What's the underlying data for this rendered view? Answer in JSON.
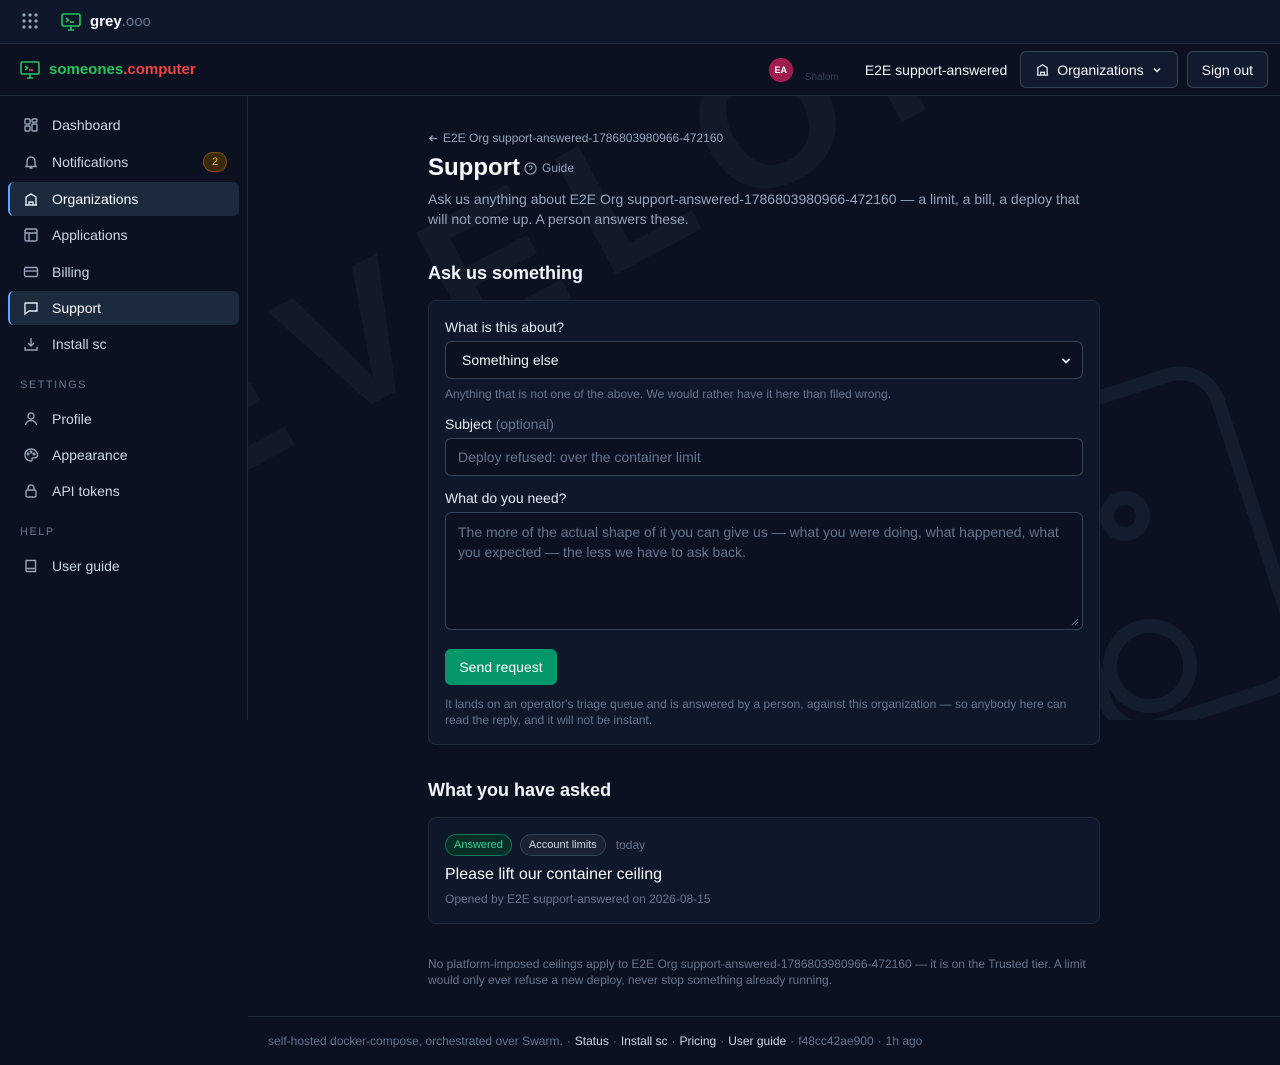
{
  "topbar": {
    "brand_name": "grey",
    "brand_tld": ".ooo"
  },
  "header": {
    "brand_name": "someones",
    "brand_tld": ".computer",
    "avatar_initials": "EA",
    "avatar_sub": "Shalom",
    "user_name": "E2E support-answered",
    "org_button": "Organizations",
    "signout_button": "Sign out"
  },
  "sidebar": {
    "items": [
      {
        "label": "Dashboard"
      },
      {
        "label": "Notifications",
        "badge": "2"
      },
      {
        "label": "Organizations"
      },
      {
        "label": "Applications"
      },
      {
        "label": "Billing"
      },
      {
        "label": "Support"
      },
      {
        "label": "Install sc"
      }
    ],
    "settings_heading": "SETTINGS",
    "settings": [
      {
        "label": "Profile"
      },
      {
        "label": "Appearance"
      },
      {
        "label": "API tokens"
      }
    ],
    "help_heading": "HELP",
    "help": [
      {
        "label": "User guide"
      }
    ]
  },
  "watermark": "DEVELOPER",
  "main": {
    "back_link": "E2E Org support-answered-1786803980966-472160",
    "title": "Support",
    "guide_label": "Guide",
    "intro": "Ask us anything about E2E Org support-answered-1786803980966-472160 — a limit, a bill, a deploy that will not come up. A person answers these.",
    "ask_heading": "Ask us something",
    "form": {
      "topic_label": "What is this about?",
      "topic_value": "Something else",
      "topic_help": "Anything that is not one of the above. We would rather have it here than filed wrong.",
      "subject_label": "Subject",
      "subject_optional": "(optional)",
      "subject_placeholder": "Deploy refused: over the container limit",
      "need_label": "What do you need?",
      "need_placeholder": "The more of the actual shape of it you can give us — what you were doing, what happened, what you expected — the less we have to ask back.",
      "send_button": "Send request",
      "send_note": "It lands on an operator's triage queue and is answered by a person, against this organization — so anybody here can read the reply, and it will not be instant."
    },
    "asked_heading": "What you have asked",
    "requests": [
      {
        "status": "Answered",
        "category": "Account limits",
        "when": "today",
        "title": "Please lift our container ceiling",
        "meta": "Opened by E2E support-answered on 2026-08-15"
      }
    ],
    "footnote": "No platform-imposed ceilings apply to E2E Org support-answered-1786803980966-472160 — it is on the Trusted tier. A limit would only ever refuse a new deploy, never stop something already running."
  },
  "footer": {
    "text": "self-hosted docker-compose, orchestrated over Swarm.",
    "links": [
      "Status",
      "Install sc",
      "Pricing",
      "User guide"
    ],
    "commit": "f48cc42ae900",
    "age": "1h ago"
  },
  "colors": {
    "accent": "#059669",
    "brand": "#22c55e",
    "brand_tld": "#ef4444",
    "active_border": "#60a5fa"
  }
}
